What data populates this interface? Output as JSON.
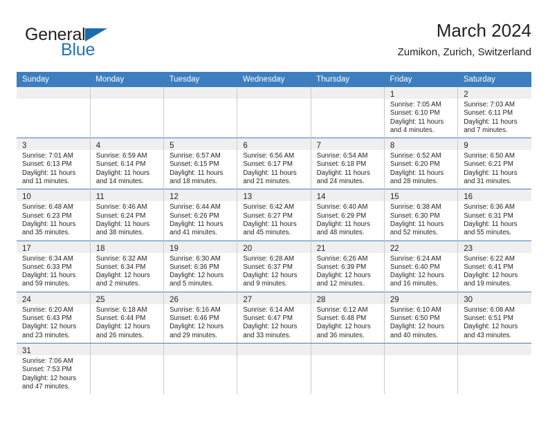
{
  "brand": {
    "name_part1": "General",
    "name_part2": "Blue",
    "triangle_icon": "triangle-icon"
  },
  "header": {
    "title": "March 2024",
    "subtitle": "Zumikon, Zurich, Switzerland"
  },
  "colors": {
    "header_blue": "#3d7ebf",
    "brand_blue": "#2272b4",
    "daynum_band": "#efefef",
    "text": "#231f20",
    "column_rule": "#c9c9c9"
  },
  "weekdays": [
    "Sunday",
    "Monday",
    "Tuesday",
    "Wednesday",
    "Thursday",
    "Friday",
    "Saturday"
  ],
  "weeks": [
    [
      {
        "empty": true
      },
      {
        "empty": true
      },
      {
        "empty": true
      },
      {
        "empty": true
      },
      {
        "empty": true
      },
      {
        "day": "1",
        "sunrise": "Sunrise: 7:05 AM",
        "sunset": "Sunset: 6:10 PM",
        "daylight1": "Daylight: 11 hours",
        "daylight2": "and 4 minutes."
      },
      {
        "day": "2",
        "sunrise": "Sunrise: 7:03 AM",
        "sunset": "Sunset: 6:11 PM",
        "daylight1": "Daylight: 11 hours",
        "daylight2": "and 7 minutes."
      }
    ],
    [
      {
        "day": "3",
        "sunrise": "Sunrise: 7:01 AM",
        "sunset": "Sunset: 6:13 PM",
        "daylight1": "Daylight: 11 hours",
        "daylight2": "and 11 minutes."
      },
      {
        "day": "4",
        "sunrise": "Sunrise: 6:59 AM",
        "sunset": "Sunset: 6:14 PM",
        "daylight1": "Daylight: 11 hours",
        "daylight2": "and 14 minutes."
      },
      {
        "day": "5",
        "sunrise": "Sunrise: 6:57 AM",
        "sunset": "Sunset: 6:15 PM",
        "daylight1": "Daylight: 11 hours",
        "daylight2": "and 18 minutes."
      },
      {
        "day": "6",
        "sunrise": "Sunrise: 6:56 AM",
        "sunset": "Sunset: 6:17 PM",
        "daylight1": "Daylight: 11 hours",
        "daylight2": "and 21 minutes."
      },
      {
        "day": "7",
        "sunrise": "Sunrise: 6:54 AM",
        "sunset": "Sunset: 6:18 PM",
        "daylight1": "Daylight: 11 hours",
        "daylight2": "and 24 minutes."
      },
      {
        "day": "8",
        "sunrise": "Sunrise: 6:52 AM",
        "sunset": "Sunset: 6:20 PM",
        "daylight1": "Daylight: 11 hours",
        "daylight2": "and 28 minutes."
      },
      {
        "day": "9",
        "sunrise": "Sunrise: 6:50 AM",
        "sunset": "Sunset: 6:21 PM",
        "daylight1": "Daylight: 11 hours",
        "daylight2": "and 31 minutes."
      }
    ],
    [
      {
        "day": "10",
        "sunrise": "Sunrise: 6:48 AM",
        "sunset": "Sunset: 6:23 PM",
        "daylight1": "Daylight: 11 hours",
        "daylight2": "and 35 minutes."
      },
      {
        "day": "11",
        "sunrise": "Sunrise: 6:46 AM",
        "sunset": "Sunset: 6:24 PM",
        "daylight1": "Daylight: 11 hours",
        "daylight2": "and 38 minutes."
      },
      {
        "day": "12",
        "sunrise": "Sunrise: 6:44 AM",
        "sunset": "Sunset: 6:26 PM",
        "daylight1": "Daylight: 11 hours",
        "daylight2": "and 41 minutes."
      },
      {
        "day": "13",
        "sunrise": "Sunrise: 6:42 AM",
        "sunset": "Sunset: 6:27 PM",
        "daylight1": "Daylight: 11 hours",
        "daylight2": "and 45 minutes."
      },
      {
        "day": "14",
        "sunrise": "Sunrise: 6:40 AM",
        "sunset": "Sunset: 6:29 PM",
        "daylight1": "Daylight: 11 hours",
        "daylight2": "and 48 minutes."
      },
      {
        "day": "15",
        "sunrise": "Sunrise: 6:38 AM",
        "sunset": "Sunset: 6:30 PM",
        "daylight1": "Daylight: 11 hours",
        "daylight2": "and 52 minutes."
      },
      {
        "day": "16",
        "sunrise": "Sunrise: 6:36 AM",
        "sunset": "Sunset: 6:31 PM",
        "daylight1": "Daylight: 11 hours",
        "daylight2": "and 55 minutes."
      }
    ],
    [
      {
        "day": "17",
        "sunrise": "Sunrise: 6:34 AM",
        "sunset": "Sunset: 6:33 PM",
        "daylight1": "Daylight: 11 hours",
        "daylight2": "and 59 minutes."
      },
      {
        "day": "18",
        "sunrise": "Sunrise: 6:32 AM",
        "sunset": "Sunset: 6:34 PM",
        "daylight1": "Daylight: 12 hours",
        "daylight2": "and 2 minutes."
      },
      {
        "day": "19",
        "sunrise": "Sunrise: 6:30 AM",
        "sunset": "Sunset: 6:36 PM",
        "daylight1": "Daylight: 12 hours",
        "daylight2": "and 5 minutes."
      },
      {
        "day": "20",
        "sunrise": "Sunrise: 6:28 AM",
        "sunset": "Sunset: 6:37 PM",
        "daylight1": "Daylight: 12 hours",
        "daylight2": "and 9 minutes."
      },
      {
        "day": "21",
        "sunrise": "Sunrise: 6:26 AM",
        "sunset": "Sunset: 6:39 PM",
        "daylight1": "Daylight: 12 hours",
        "daylight2": "and 12 minutes."
      },
      {
        "day": "22",
        "sunrise": "Sunrise: 6:24 AM",
        "sunset": "Sunset: 6:40 PM",
        "daylight1": "Daylight: 12 hours",
        "daylight2": "and 16 minutes."
      },
      {
        "day": "23",
        "sunrise": "Sunrise: 6:22 AM",
        "sunset": "Sunset: 6:41 PM",
        "daylight1": "Daylight: 12 hours",
        "daylight2": "and 19 minutes."
      }
    ],
    [
      {
        "day": "24",
        "sunrise": "Sunrise: 6:20 AM",
        "sunset": "Sunset: 6:43 PM",
        "daylight1": "Daylight: 12 hours",
        "daylight2": "and 23 minutes."
      },
      {
        "day": "25",
        "sunrise": "Sunrise: 6:18 AM",
        "sunset": "Sunset: 6:44 PM",
        "daylight1": "Daylight: 12 hours",
        "daylight2": "and 26 minutes."
      },
      {
        "day": "26",
        "sunrise": "Sunrise: 6:16 AM",
        "sunset": "Sunset: 6:46 PM",
        "daylight1": "Daylight: 12 hours",
        "daylight2": "and 29 minutes."
      },
      {
        "day": "27",
        "sunrise": "Sunrise: 6:14 AM",
        "sunset": "Sunset: 6:47 PM",
        "daylight1": "Daylight: 12 hours",
        "daylight2": "and 33 minutes."
      },
      {
        "day": "28",
        "sunrise": "Sunrise: 6:12 AM",
        "sunset": "Sunset: 6:48 PM",
        "daylight1": "Daylight: 12 hours",
        "daylight2": "and 36 minutes."
      },
      {
        "day": "29",
        "sunrise": "Sunrise: 6:10 AM",
        "sunset": "Sunset: 6:50 PM",
        "daylight1": "Daylight: 12 hours",
        "daylight2": "and 40 minutes."
      },
      {
        "day": "30",
        "sunrise": "Sunrise: 6:08 AM",
        "sunset": "Sunset: 6:51 PM",
        "daylight1": "Daylight: 12 hours",
        "daylight2": "and 43 minutes."
      }
    ],
    [
      {
        "day": "31",
        "sunrise": "Sunrise: 7:06 AM",
        "sunset": "Sunset: 7:53 PM",
        "daylight1": "Daylight: 12 hours",
        "daylight2": "and 47 minutes."
      },
      {
        "empty": true
      },
      {
        "empty": true
      },
      {
        "empty": true
      },
      {
        "empty": true
      },
      {
        "empty": true
      },
      {
        "empty": true
      }
    ]
  ]
}
